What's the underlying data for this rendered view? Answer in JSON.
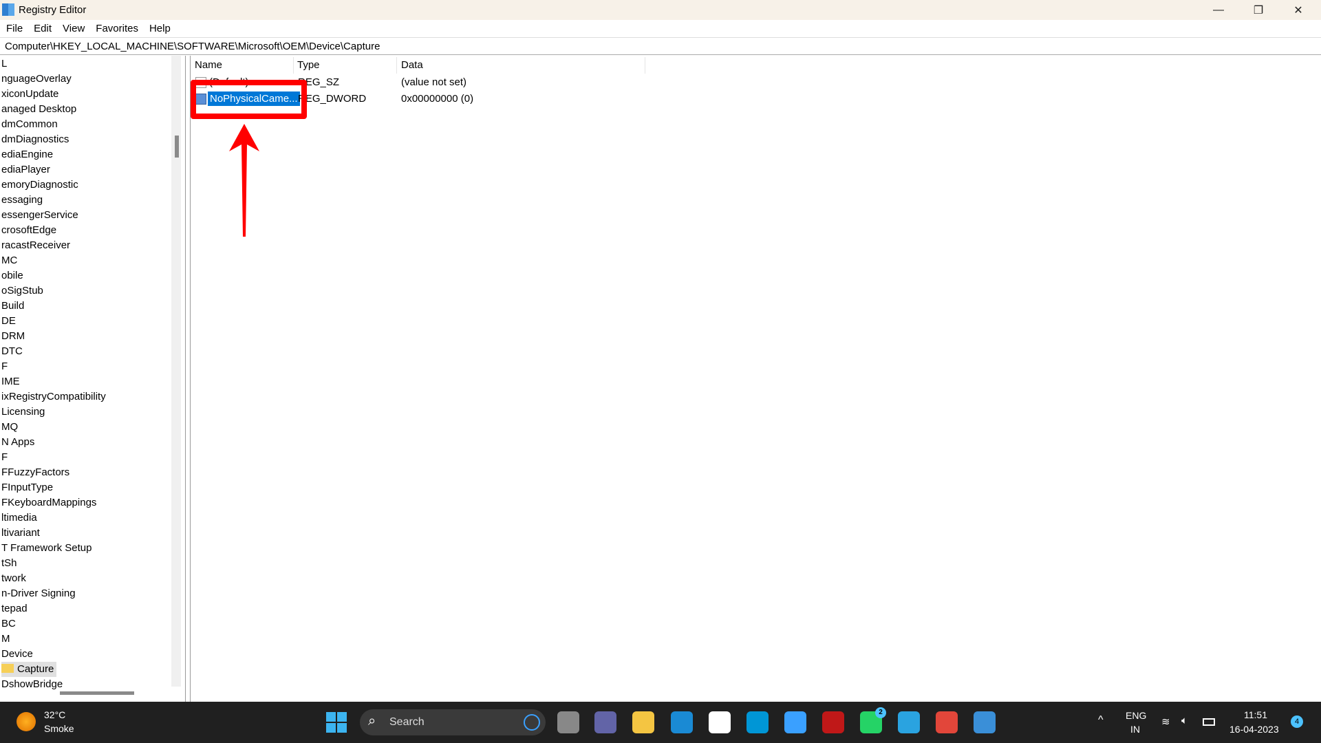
{
  "window": {
    "title": "Registry Editor",
    "minimize": "—",
    "restore": "❐",
    "close": "✕"
  },
  "menu": [
    "File",
    "Edit",
    "View",
    "Favorites",
    "Help"
  ],
  "address": "Computer\\HKEY_LOCAL_MACHINE\\SOFTWARE\\Microsoft\\OEM\\Device\\Capture",
  "tree": [
    "L",
    "nguageOverlay",
    "xiconUpdate",
    "anaged Desktop",
    "dmCommon",
    "dmDiagnostics",
    "ediaEngine",
    "ediaPlayer",
    "emoryDiagnostic",
    "essaging",
    "essengerService",
    "crosoftEdge",
    "racastReceiver",
    "MC",
    "obile",
    "oSigStub",
    "Build",
    "DE",
    "DRM",
    "DTC",
    "F",
    "IME",
    "ixRegistryCompatibility",
    "Licensing",
    "MQ",
    "N Apps",
    "F",
    "FFuzzyFactors",
    "FInputType",
    "FKeyboardMappings",
    "ltimedia",
    "ltivariant",
    "T Framework Setup",
    "tSh",
    "twork",
    "n-Driver Signing",
    "tepad",
    "BC",
    "M",
    "Device",
    "Capture",
    "DshowBridge"
  ],
  "tree_selected": "Capture",
  "columns": [
    "Name",
    "Type",
    "Data"
  ],
  "rows": [
    {
      "name": "(Default)",
      "type": "REG_SZ",
      "data": "(value not set)",
      "icon": "string-value-icon"
    },
    {
      "name": "NoPhysicalCame...",
      "type": "REG_DWORD",
      "data": "0x00000000 (0)",
      "icon": "dword-value-icon",
      "selected": true
    }
  ],
  "annotation": {
    "color": "#ff0000"
  },
  "taskbar": {
    "weather": {
      "temp": "32°C",
      "desc": "Smoke"
    },
    "search": "Search",
    "apps": [
      {
        "icon": "task-view-icon",
        "color": "#888"
      },
      {
        "icon": "teams-chat-icon",
        "color": "#6264a7"
      },
      {
        "icon": "file-explorer-icon",
        "color": "#f4c542"
      },
      {
        "icon": "edge-icon",
        "color": "#1a8ad4"
      },
      {
        "icon": "microsoft-store-icon",
        "color": "#ffffff"
      },
      {
        "icon": "myhp-icon",
        "color": "#0096d6"
      },
      {
        "icon": "help-icon",
        "color": "#3aa0ff"
      },
      {
        "icon": "mcafee-icon",
        "color": "#c01818"
      },
      {
        "icon": "whatsapp-icon",
        "color": "#25d366",
        "badge": "2"
      },
      {
        "icon": "telegram-icon",
        "color": "#2aa3e0"
      },
      {
        "icon": "chrome-icon",
        "color": "#e2463a"
      },
      {
        "icon": "registry-editor-icon",
        "color": "#3a8fd8"
      }
    ],
    "lang": "ENG",
    "region": "IN",
    "time": "11:51",
    "date": "16-04-2023",
    "notifications": "4"
  }
}
